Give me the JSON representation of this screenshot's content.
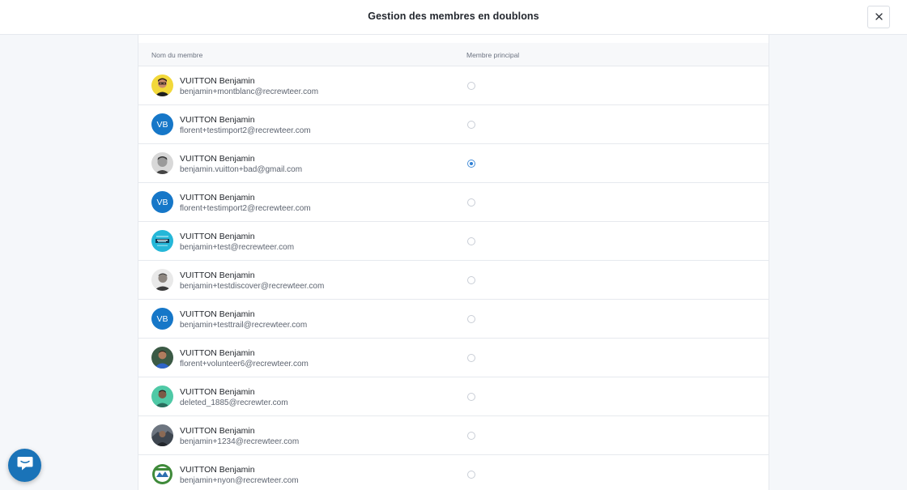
{
  "modal": {
    "title": "Gestion des membres en doublons",
    "close_icon": "close-icon"
  },
  "table": {
    "headers": {
      "name": "Nom du membre",
      "principal": "Membre principal"
    },
    "rows": [
      {
        "name": "VUITTON Benjamin",
        "email": "benjamin+montblanc@recrewteer.com",
        "avatar": "photo-yellow",
        "selected": false
      },
      {
        "name": "VUITTON Benjamin",
        "email": "florent+testimport2@recrewteer.com",
        "avatar": "initials",
        "initials": "VB",
        "selected": false
      },
      {
        "name": "VUITTON Benjamin",
        "email": "benjamin.vuitton+bad@gmail.com",
        "avatar": "photo-grey",
        "selected": true
      },
      {
        "name": "VUITTON Benjamin",
        "email": "florent+testimport2@recrewteer.com",
        "avatar": "initials",
        "initials": "VB",
        "selected": false
      },
      {
        "name": "VUITTON Benjamin",
        "email": "benjamin+test@recrewteer.com",
        "avatar": "photo-cyan",
        "selected": false
      },
      {
        "name": "VUITTON Benjamin",
        "email": "benjamin+testdiscover@recrewteer.com",
        "avatar": "photo-grey2",
        "selected": false
      },
      {
        "name": "VUITTON Benjamin",
        "email": "benjamin+testtrail@recrewteer.com",
        "avatar": "initials",
        "initials": "VB",
        "selected": false
      },
      {
        "name": "VUITTON Benjamin",
        "email": "florent+volunteer6@recrewteer.com",
        "avatar": "photo-blue",
        "selected": false
      },
      {
        "name": "VUITTON Benjamin",
        "email": "deleted_1885@recrewter.com",
        "avatar": "photo-teal",
        "selected": false
      },
      {
        "name": "VUITTON Benjamin",
        "email": "benjamin+1234@recrewteer.com",
        "avatar": "photo-dark",
        "selected": false
      },
      {
        "name": "VUITTON Benjamin",
        "email": "benjamin+nyon@recrewteer.com",
        "avatar": "photo-badge",
        "selected": false
      }
    ]
  },
  "chat": {
    "icon": "chat-bubble-icon",
    "color": "#1a73b8"
  },
  "colors": {
    "accent": "#2f7fd4",
    "initials_bg": "#1677c8"
  }
}
